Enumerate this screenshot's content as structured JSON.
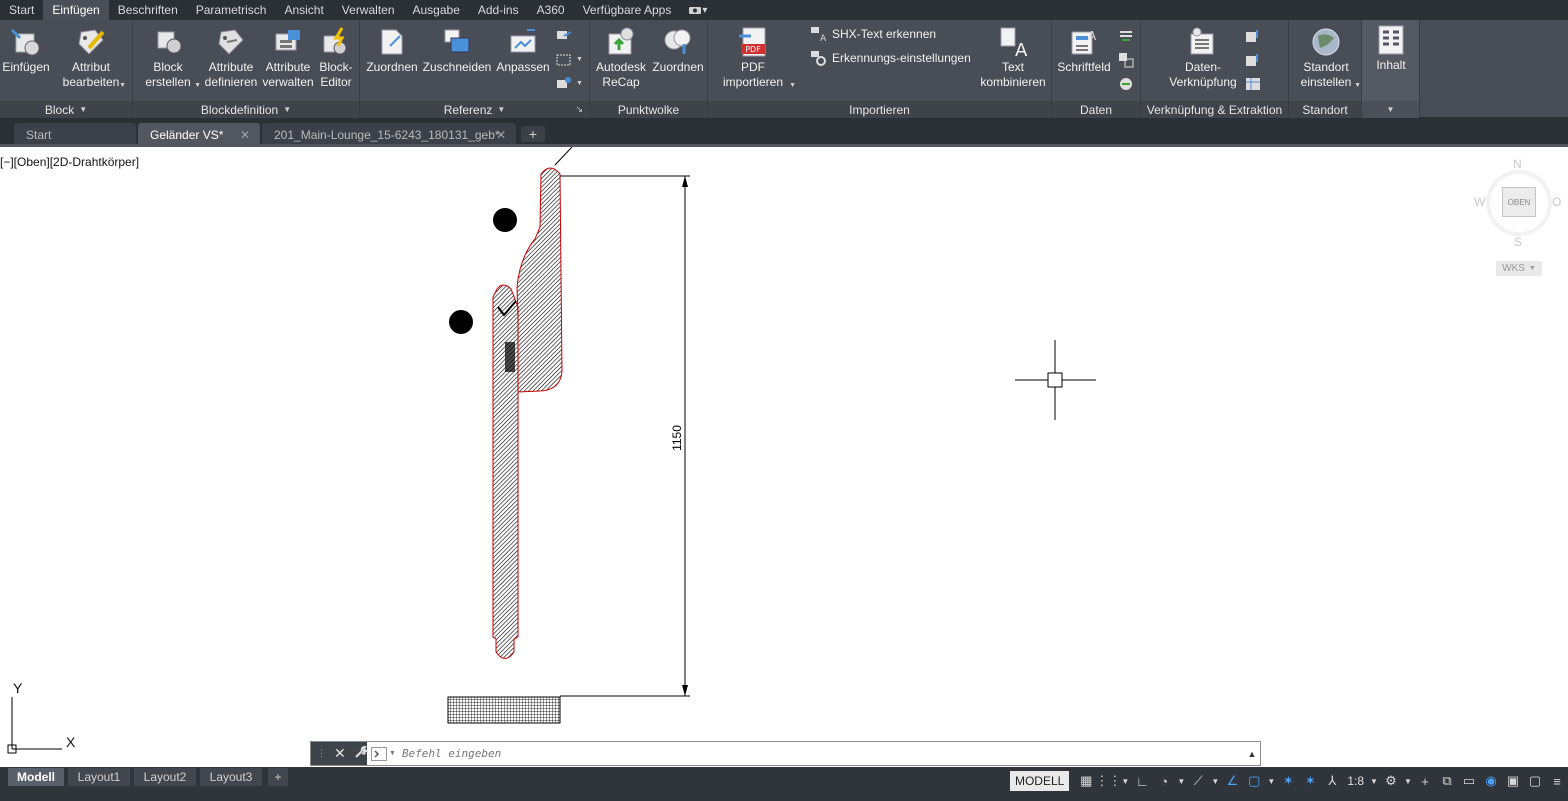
{
  "ribbon_tabs": [
    "Start",
    "Einfügen",
    "Beschriften",
    "Parametrisch",
    "Ansicht",
    "Verwalten",
    "Ausgabe",
    "Add-ins",
    "A360",
    "Verfügbare Apps"
  ],
  "ribbon_tab_extra": "▾",
  "panels": {
    "block": {
      "title": "Block",
      "buttons": [
        {
          "line1": "Einfügen",
          "line2": ""
        },
        {
          "line1": "Attribut",
          "line2": "bearbeiten"
        }
      ]
    },
    "blockdef": {
      "title": "Blockdefinition",
      "buttons": [
        {
          "line1": "Block",
          "line2": "erstellen"
        },
        {
          "line1": "Attribute",
          "line2": "definieren"
        },
        {
          "line1": "Attribute",
          "line2": "verwalten"
        },
        {
          "line1": "Block-",
          "line2": "Editor"
        }
      ]
    },
    "referenz": {
      "title": "Referenz",
      "buttons": [
        {
          "line1": "Zuordnen",
          "line2": ""
        },
        {
          "line1": "Zuschneiden",
          "line2": ""
        },
        {
          "line1": "Anpassen",
          "line2": ""
        }
      ]
    },
    "punktwolke": {
      "title": "Punktwolke",
      "buttons": [
        {
          "line1": "Autodesk",
          "line2": "ReCap"
        },
        {
          "line1": "Zuordnen",
          "line2": ""
        }
      ]
    },
    "importieren": {
      "title": "Importieren",
      "pdf": {
        "line1": "PDF",
        "line2": "importieren",
        "badge": "PDF"
      },
      "shx_label": "SHX-Text erkennen",
      "erkennung_label": "Erkennungs-einstellungen",
      "text": {
        "line1": "Text",
        "line2": "kombinieren"
      }
    },
    "daten": {
      "title": "Daten",
      "schriftfeld": "Schriftfeld"
    },
    "verknuepfung": {
      "title": "Verknüpfung & Extraktion",
      "datenverknuepfung": {
        "line1": "Daten-",
        "line2": "Verknüpfung"
      }
    },
    "standort": {
      "title": "Standort",
      "button": {
        "line1": "Standort",
        "line2": "einstellen"
      }
    },
    "inhalt": {
      "label": "Inhalt"
    }
  },
  "doc_tabs": [
    "Start",
    "Geländer VS*",
    "201_Main-Lounge_15-6243_180131_geb*"
  ],
  "doc_tab_close": "✕",
  "new_tab_label": "+",
  "viewport_label": "[−][Oben][2D-Drahtkörper]",
  "viewcube": {
    "n": "N",
    "s": "S",
    "w": "W",
    "e": "O",
    "face": "OBEN",
    "wks": "WKS"
  },
  "ucs": {
    "x": "X",
    "y": "Y"
  },
  "dimension_text": "1150",
  "command": {
    "placeholder": "Befehl eingeben"
  },
  "layout_tabs": [
    "Modell",
    "Layout1",
    "Layout2",
    "Layout3"
  ],
  "layout_add": "+",
  "status": {
    "model": "MODELL",
    "scale": "1:8"
  }
}
